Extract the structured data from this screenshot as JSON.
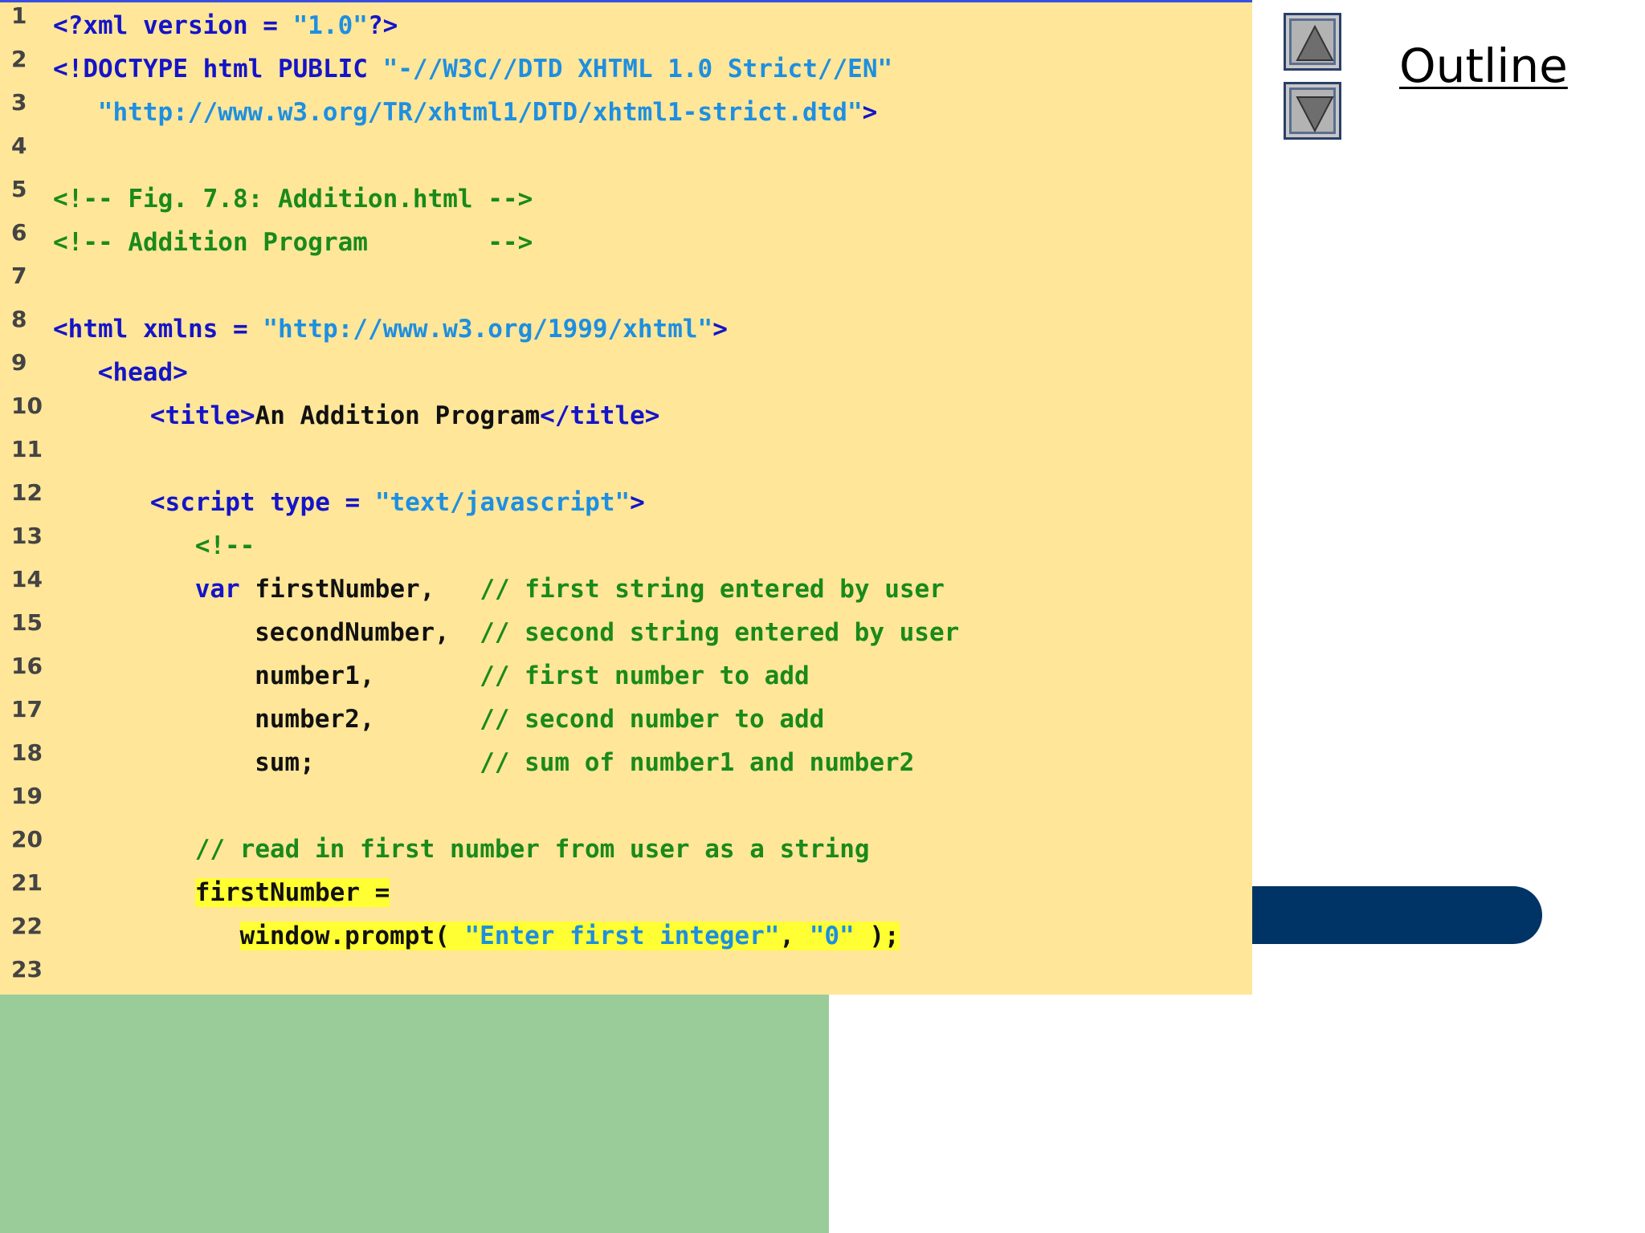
{
  "slide": {
    "outline_label": "Outline",
    "nav": [
      {
        "icon": "triangle-up-icon",
        "label": "previous"
      },
      {
        "icon": "triangle-down-icon",
        "label": "next"
      }
    ],
    "colors": {
      "code_bg": "#ffe699",
      "green_panel": "#99cc99",
      "navy_bar": "#003366",
      "highlight": "#ffff33",
      "tag": "#1414c8",
      "string": "#1e8fe0",
      "comment": "#1a8a1a",
      "text": "#111111"
    }
  },
  "code_lines": [
    {
      "num": "1",
      "indent": 0,
      "segs": [
        {
          "t": "<?xml version = ",
          "c": "tag"
        },
        {
          "t": "\"1.0\"",
          "c": "str"
        },
        {
          "t": "?>",
          "c": "tag"
        }
      ]
    },
    {
      "num": "2",
      "indent": 0,
      "segs": [
        {
          "t": "<!DOCTYPE html PUBLIC ",
          "c": "tag"
        },
        {
          "t": "\"-//W3C//DTD XHTML 1.0 Strict//EN\"",
          "c": "str"
        }
      ]
    },
    {
      "num": "3",
      "indent": 3,
      "segs": [
        {
          "t": "\"http://www.w3.org/TR/xhtml1/DTD/xhtml1-strict.dtd\"",
          "c": "str"
        },
        {
          "t": ">",
          "c": "tag"
        }
      ]
    },
    {
      "num": "4",
      "indent": 0,
      "segs": []
    },
    {
      "num": "5",
      "indent": 0,
      "segs": [
        {
          "t": "<!-- Fig. 7.8: Addition.html -->",
          "c": "com"
        }
      ]
    },
    {
      "num": "6",
      "indent": 0,
      "segs": [
        {
          "t": "<!-- Addition Program        -->",
          "c": "com"
        }
      ]
    },
    {
      "num": "7",
      "indent": 0,
      "segs": []
    },
    {
      "num": "8",
      "indent": 0,
      "segs": [
        {
          "t": "<html xmlns = ",
          "c": "tag"
        },
        {
          "t": "\"http://www.w3.org/1999/xhtml\"",
          "c": "str"
        },
        {
          "t": ">",
          "c": "tag"
        }
      ]
    },
    {
      "num": "9",
      "indent": 3,
      "segs": [
        {
          "t": "<head>",
          "c": "tag"
        }
      ]
    },
    {
      "num": "10",
      "indent": 6.5,
      "segs": [
        {
          "t": "<title>",
          "c": "tag"
        },
        {
          "t": "An Addition Program",
          "c": "txt"
        },
        {
          "t": "</title>",
          "c": "tag"
        }
      ]
    },
    {
      "num": "11",
      "indent": 0,
      "segs": []
    },
    {
      "num": "12",
      "indent": 6.5,
      "segs": [
        {
          "t": "<script type = ",
          "c": "tag"
        },
        {
          "t": "\"text/javascript\"",
          "c": "str"
        },
        {
          "t": ">",
          "c": "tag"
        }
      ]
    },
    {
      "num": "13",
      "indent": 9.5,
      "segs": [
        {
          "t": "<!--",
          "c": "com"
        }
      ]
    },
    {
      "num": "14",
      "indent": 9.5,
      "segs": [
        {
          "t": "var ",
          "c": "kw"
        },
        {
          "t": "firstNumber,   ",
          "c": "txt"
        },
        {
          "t": "// first string entered by user",
          "c": "com"
        }
      ]
    },
    {
      "num": "15",
      "indent": 13.5,
      "segs": [
        {
          "t": "secondNumber,  ",
          "c": "txt"
        },
        {
          "t": "// second string entered by user",
          "c": "com"
        }
      ]
    },
    {
      "num": "16",
      "indent": 13.5,
      "segs": [
        {
          "t": "number1,       ",
          "c": "txt"
        },
        {
          "t": "// first number to add",
          "c": "com"
        }
      ]
    },
    {
      "num": "17",
      "indent": 13.5,
      "segs": [
        {
          "t": "number2,       ",
          "c": "txt"
        },
        {
          "t": "// second number to add",
          "c": "com"
        }
      ]
    },
    {
      "num": "18",
      "indent": 13.5,
      "segs": [
        {
          "t": "sum;           ",
          "c": "txt"
        },
        {
          "t": "// sum of number1 and number2",
          "c": "com"
        }
      ]
    },
    {
      "num": "19",
      "indent": 0,
      "segs": []
    },
    {
      "num": "20",
      "indent": 9.5,
      "segs": [
        {
          "t": "// read in first number from user as a string",
          "c": "com"
        }
      ]
    },
    {
      "num": "21",
      "indent": 9.5,
      "segs": [
        {
          "t": "firstNumber =",
          "c": "txt",
          "hl": true
        }
      ]
    },
    {
      "num": "22",
      "indent": 12.5,
      "segs": [
        {
          "t": "window.prompt( ",
          "c": "txt",
          "hl": true
        },
        {
          "t": "\"Enter first integer\"",
          "c": "str",
          "hl": true
        },
        {
          "t": ", ",
          "c": "txt",
          "hl": true
        },
        {
          "t": "\"0\"",
          "c": "str",
          "hl": true
        },
        {
          "t": " );",
          "c": "txt",
          "hl": true
        }
      ]
    },
    {
      "num": "23",
      "indent": 0,
      "segs": []
    }
  ]
}
